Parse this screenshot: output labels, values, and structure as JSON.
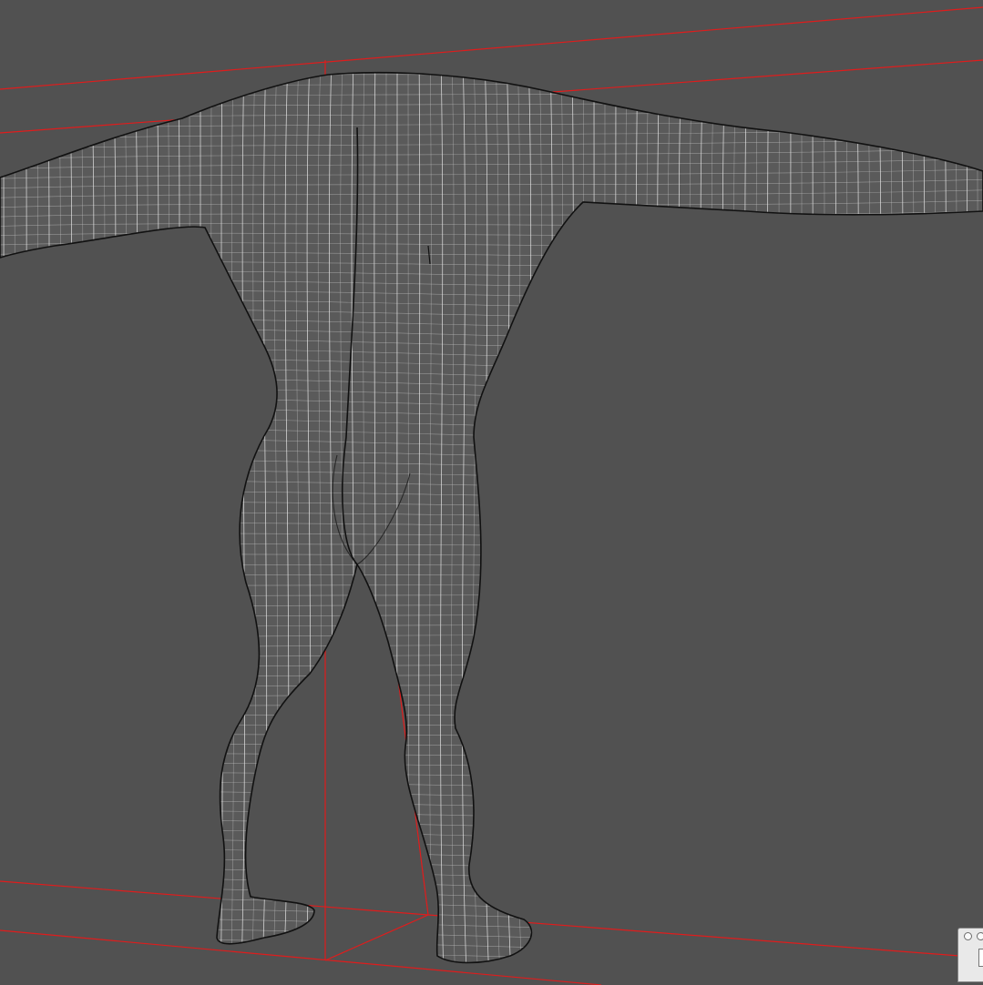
{
  "viewport": {
    "view_name": "3d-viewport-back",
    "background_color": "#515151"
  },
  "model": {
    "wire_color": "#e8e8e8",
    "silhouette_color": "#111111"
  },
  "bounding_box": {
    "color": "#e01c1c"
  },
  "mini_window": {
    "button_icons": [
      "close-button-icon",
      "minimize-button-icon"
    ]
  }
}
